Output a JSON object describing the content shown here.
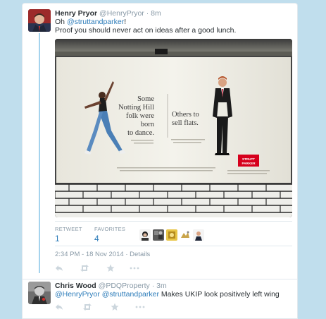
{
  "tweet": {
    "author_name": "Henry Pryor",
    "author_handle": "@HenryPryor",
    "separator": "·",
    "time_ago": "8m",
    "line1_prefix": "Oh ",
    "line1_mention": "@struttandparker",
    "line1_suffix": "!",
    "line2": "Proof you should never act on ideas after a good lunch.",
    "media": {
      "ad_left_text": [
        "Some",
        "Notting Hill",
        "folk were",
        "born",
        "to dance."
      ],
      "ad_right_text": [
        "Others to",
        "sell flats."
      ],
      "brand_logo": [
        "STRUTT",
        "PARKER"
      ]
    },
    "stats": {
      "retweet_label": "RETWEET",
      "retweet_count": "1",
      "favorites_label": "FAVORITES",
      "favorites_count": "4"
    },
    "timestamp": "2:34 PM - 18 Nov 2014",
    "details_separator": " · ",
    "details_link": "Details"
  },
  "reply": {
    "author_name": "Chris Wood",
    "author_handle": "@PDQProperty",
    "separator": "·",
    "time_ago": "3m",
    "mention1": "@HenryPryor",
    "mention2": "@struttandparker",
    "text": " Makes UKIP look positively left wing"
  },
  "actions": {
    "reply_icon": "reply-icon",
    "retweet_icon": "retweet-icon",
    "favorite_icon": "star-icon",
    "more_icon": "more-icon"
  },
  "colors": {
    "background": "#c0deed",
    "link": "#2b7bb9",
    "muted": "#8899a6",
    "thread_line": "#a5d3ed",
    "brand_red": "#d6001c"
  }
}
